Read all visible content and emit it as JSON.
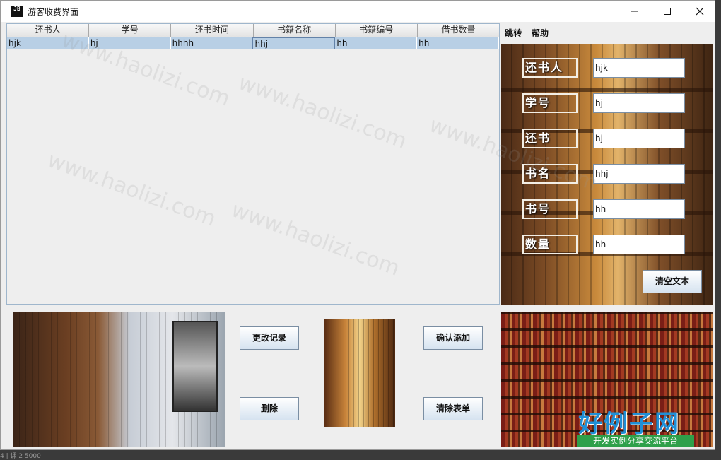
{
  "window": {
    "icon_text": "JB",
    "title": "游客收费界面"
  },
  "table": {
    "columns": [
      "还书人",
      "学号",
      "还书时间",
      "书籍名称",
      "书籍编号",
      "借书数量"
    ],
    "rows": [
      [
        "hjk",
        "hj",
        "hhhh",
        "hhj",
        "hh",
        "hh"
      ]
    ]
  },
  "menu": {
    "items": [
      "跳转",
      "帮助"
    ]
  },
  "form": {
    "labels": [
      "还书人",
      "学号",
      "还书",
      "书名",
      "书号",
      "数量"
    ],
    "values": [
      "hjk",
      "hj",
      "hj",
      "hhj",
      "hh",
      "hh"
    ],
    "clear_label": "清空文本"
  },
  "actions": {
    "modify_label": "更改记录",
    "delete_label": "删除",
    "confirm_label": "确认添加",
    "clear_form_label": "清除表单"
  },
  "watermark": {
    "text": "www.haolizi.com",
    "logo_main": "好例子网",
    "logo_sub": "开发实例分享交流平台"
  },
  "statusbar": {
    "text": "4 | 课 2 5000"
  },
  "colors": {
    "row_selected": "#b8cfe5",
    "logo_blue": "#1f8fd6",
    "logo_green": "#2ea04a"
  }
}
